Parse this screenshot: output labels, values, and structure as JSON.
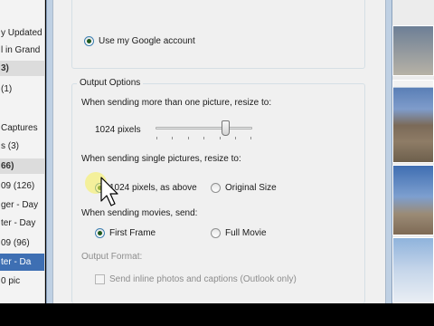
{
  "left_panel": {
    "items": [
      {
        "text": "y Updated",
        "kind": "normal"
      },
      {
        "text": "l in Grand",
        "kind": "normal"
      },
      {
        "text": "3)",
        "kind": "section"
      },
      {
        "text": "(1)",
        "kind": "normal"
      },
      {
        "text": "",
        "kind": "normal"
      },
      {
        "text": "Captures",
        "kind": "normal"
      },
      {
        "text": "s (3)",
        "kind": "normal"
      },
      {
        "text": "66)",
        "kind": "section"
      },
      {
        "text": "09 (126)",
        "kind": "normal"
      },
      {
        "text": "ger - Day",
        "kind": "normal"
      },
      {
        "text": "ter - Day",
        "kind": "normal"
      },
      {
        "text": "09 (96)",
        "kind": "normal"
      },
      {
        "text": "ter - Da",
        "kind": "selected"
      },
      {
        "text": "0 pic",
        "kind": "normal"
      }
    ]
  },
  "account": {
    "use_google_label": "Use my Google account",
    "use_google_selected": true
  },
  "output_options": {
    "title": "Output Options",
    "multi_resize_label": "When sending more than one picture, resize to:",
    "multi_resize_value": "1024 pixels",
    "multi_resize_slider_level": 0.76,
    "single_resize_label": "When sending single pictures, resize to:",
    "single_option_same": "1024 pixels, as above",
    "single_option_original": "Original Size",
    "single_selected": "same",
    "movies_label": "When sending movies, send:",
    "movie_option_first_frame": "First Frame",
    "movie_option_full_movie": "Full Movie",
    "movie_selected": "first_frame",
    "output_format_label": "Output Format:",
    "inline_photos_label": "Send inline photos and captions (Outlook only)",
    "inline_photos_checked": false,
    "inline_photos_enabled": false
  },
  "colors": {
    "selection": "#3e6fb3",
    "radio_dot": "#1f5a1f",
    "dialog_bg": "#f0f0f0"
  }
}
